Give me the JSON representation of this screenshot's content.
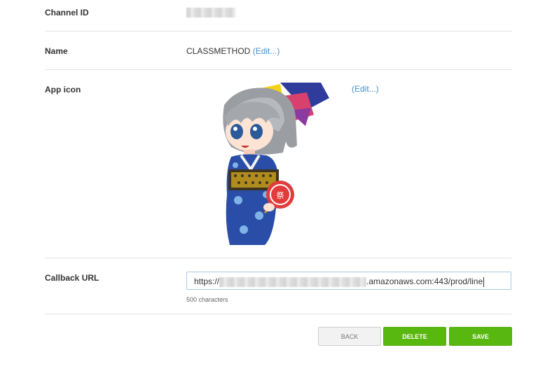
{
  "fields": {
    "channel_id": {
      "label": "Channel ID"
    },
    "name": {
      "label": "Name",
      "value": "CLASSMETHOD",
      "edit_link": "(Edit...)"
    },
    "app_icon": {
      "label": "App icon",
      "edit_link": "(Edit...)"
    },
    "callback_url": {
      "label": "Callback URL",
      "value_prefix": "https://",
      "value_suffix": ".amazonaws.com:443/prod/line",
      "hint": "500 characters"
    }
  },
  "buttons": {
    "back": "BACK",
    "delete": "DELETE",
    "save": "SAVE"
  },
  "colors": {
    "link": "#4a90c8",
    "primary_button": "#59b80f",
    "input_border": "#a9c9e6"
  },
  "icons": {
    "app_icon": "anime-girl-yukata-icon"
  }
}
